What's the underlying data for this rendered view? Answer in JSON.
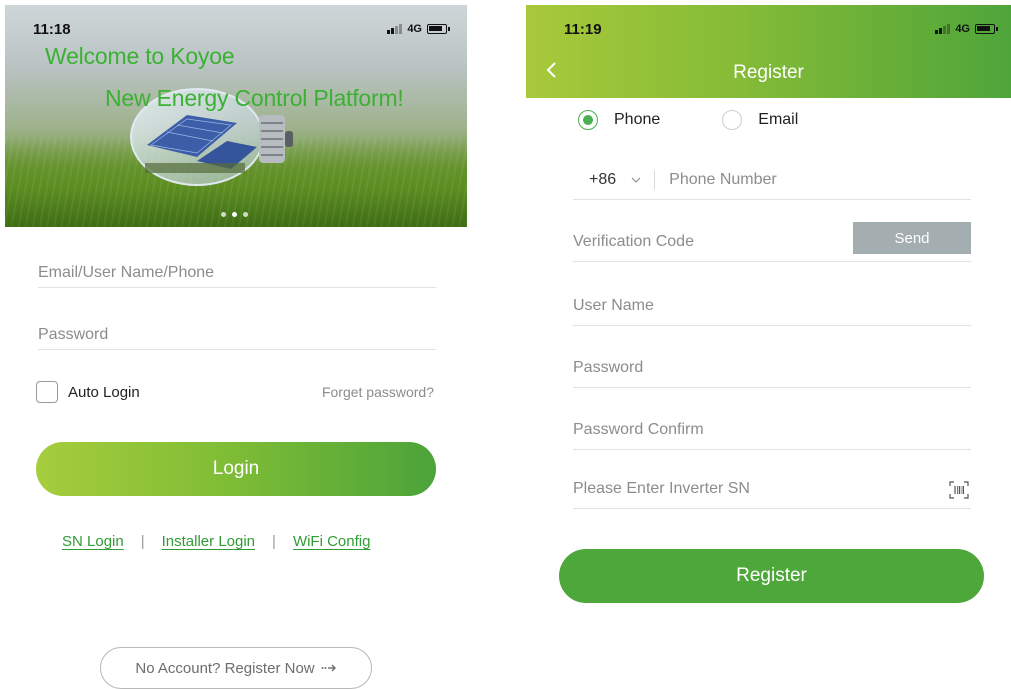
{
  "login_screen": {
    "status": {
      "time": "11:18",
      "network": "4G"
    },
    "hero": {
      "welcome": "Welcome to Koyoe",
      "platform": "New Energy Control Platform!",
      "slide_count": 3,
      "active_slide": 2
    },
    "fields": {
      "account_placeholder": "Email/User Name/Phone",
      "password_placeholder": "Password"
    },
    "auto_login": {
      "label": "Auto Login",
      "checked": false
    },
    "forget_password": "Forget password?",
    "login_button": "Login",
    "links": {
      "sn_login": "SN Login",
      "installer_login": "Installer Login",
      "wifi_config": "WiFi Config"
    },
    "register_now": "No Account? Register Now",
    "colors": {
      "accent_green": "#3bb134",
      "button_start": "#a6cd3c",
      "button_end": "#4ba33a"
    }
  },
  "register_screen": {
    "status": {
      "time": "11:19",
      "network": "4G"
    },
    "title": "Register",
    "methods": [
      {
        "label": "Phone",
        "selected": true
      },
      {
        "label": "Email",
        "selected": false
      }
    ],
    "phone": {
      "country_code": "+86",
      "placeholder": "Phone Number"
    },
    "verification": {
      "placeholder": "Verification Code",
      "send_label": "Send"
    },
    "username_placeholder": "User Name",
    "password_placeholder": "Password",
    "password_confirm_placeholder": "Password Confirm",
    "inverter_sn_placeholder": "Please Enter Inverter SN",
    "register_button": "Register",
    "colors": {
      "header_start": "#a8c93a",
      "header_end": "#4fa53a",
      "register_button": "#4ea73a",
      "send_button": "#a4adb0"
    }
  }
}
